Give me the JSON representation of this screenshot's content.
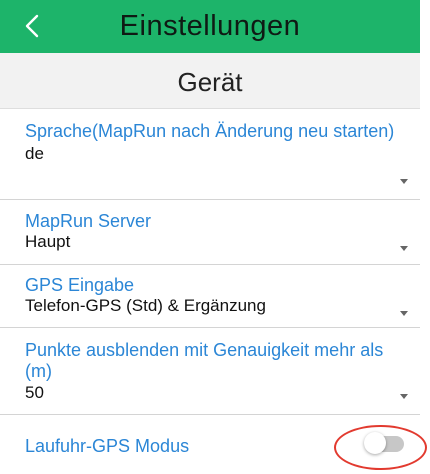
{
  "header": {
    "title": "Einstellungen",
    "back_icon": "chevron-left-icon",
    "color": "#1db46a"
  },
  "section": {
    "title": "Gerät"
  },
  "settings": [
    {
      "label": "Sprache(MapRun nach Änderung neu starten)",
      "value": "de"
    },
    {
      "label": "MapRun Server",
      "value": "Haupt"
    },
    {
      "label": "GPS Eingabe",
      "value": "Telefon-GPS (Std) & Ergänzung"
    },
    {
      "label": "Punkte ausblenden mit Genauigkeit mehr als (m)",
      "value": "50"
    }
  ],
  "watch_gps": {
    "label": "Laufuhr-GPS Modus",
    "enabled": false
  },
  "colors": {
    "label_blue": "#2b86d6",
    "highlight_red": "#e23a2f"
  }
}
